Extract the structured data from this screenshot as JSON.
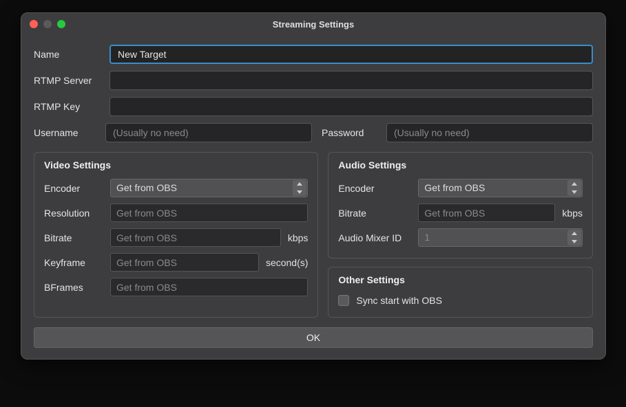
{
  "titlebar": {
    "title": "Streaming Settings"
  },
  "fields": {
    "name_label": "Name",
    "name_value": "New Target",
    "rtmp_server_label": "RTMP Server",
    "rtmp_server_value": "",
    "rtmp_key_label": "RTMP Key",
    "rtmp_key_value": "",
    "username_label": "Username",
    "username_placeholder": "(Usually no need)",
    "password_label": "Password",
    "password_placeholder": "(Usually no need)"
  },
  "video": {
    "title": "Video Settings",
    "encoder_label": "Encoder",
    "encoder_value": "Get from OBS",
    "resolution_label": "Resolution",
    "resolution_placeholder": "Get from OBS",
    "bitrate_label": "Bitrate",
    "bitrate_placeholder": "Get from OBS",
    "bitrate_unit": "kbps",
    "keyframe_label": "Keyframe",
    "keyframe_placeholder": "Get from OBS",
    "keyframe_unit": "second(s)",
    "bframes_label": "BFrames",
    "bframes_placeholder": "Get from OBS"
  },
  "audio": {
    "title": "Audio Settings",
    "encoder_label": "Encoder",
    "encoder_value": "Get from OBS",
    "bitrate_label": "Bitrate",
    "bitrate_placeholder": "Get from OBS",
    "bitrate_unit": "kbps",
    "mixer_label": "Audio Mixer ID",
    "mixer_value": "1"
  },
  "other": {
    "title": "Other Settings",
    "sync_label": "Sync start with OBS",
    "sync_checked": false
  },
  "footer": {
    "ok_label": "OK"
  }
}
